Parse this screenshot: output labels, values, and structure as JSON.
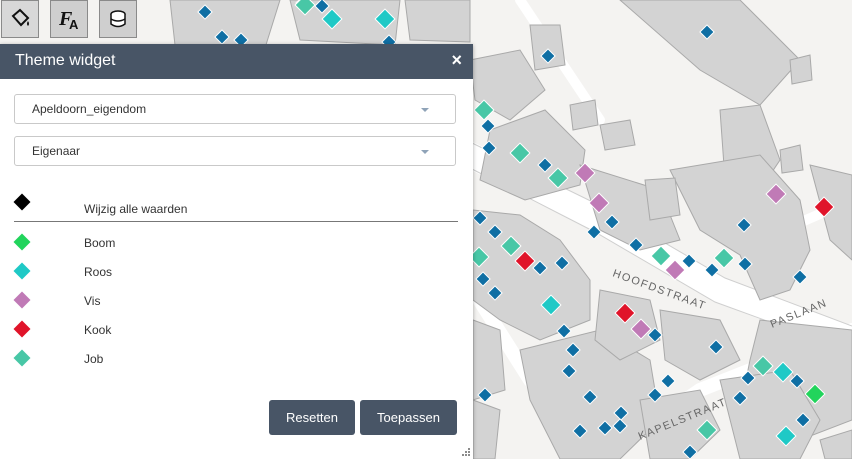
{
  "toolbar": {
    "buttons": [
      {
        "name": "theme-tool",
        "icon": "paint-bucket-icon"
      },
      {
        "name": "label-tool",
        "icon": "font-label-icon"
      },
      {
        "name": "layers-tool",
        "icon": "database-stack-icon"
      }
    ]
  },
  "panel": {
    "title": "Theme widget",
    "close_label": "×",
    "layer_select": {
      "value": "Apeldoorn_eigendom"
    },
    "field_select": {
      "value": "Eigenaar"
    },
    "all_values": {
      "label": "Wijzig alle waarden",
      "color": "#000000"
    },
    "legend": [
      {
        "label": "Boom",
        "color": "#22d45c"
      },
      {
        "label": "Roos",
        "color": "#1fc9c6"
      },
      {
        "label": "Vis",
        "color": "#c07ab6"
      },
      {
        "label": "Kook",
        "color": "#e0142a"
      },
      {
        "label": "Job",
        "color": "#48c7a6"
      }
    ],
    "reset_label": "Resetten",
    "apply_label": "Toepassen"
  },
  "map": {
    "streets": [
      "HOOFDSTRAAT",
      "PASLAAN",
      "KAPELSTRAAT"
    ],
    "marker_color": "#0f6fa4"
  }
}
